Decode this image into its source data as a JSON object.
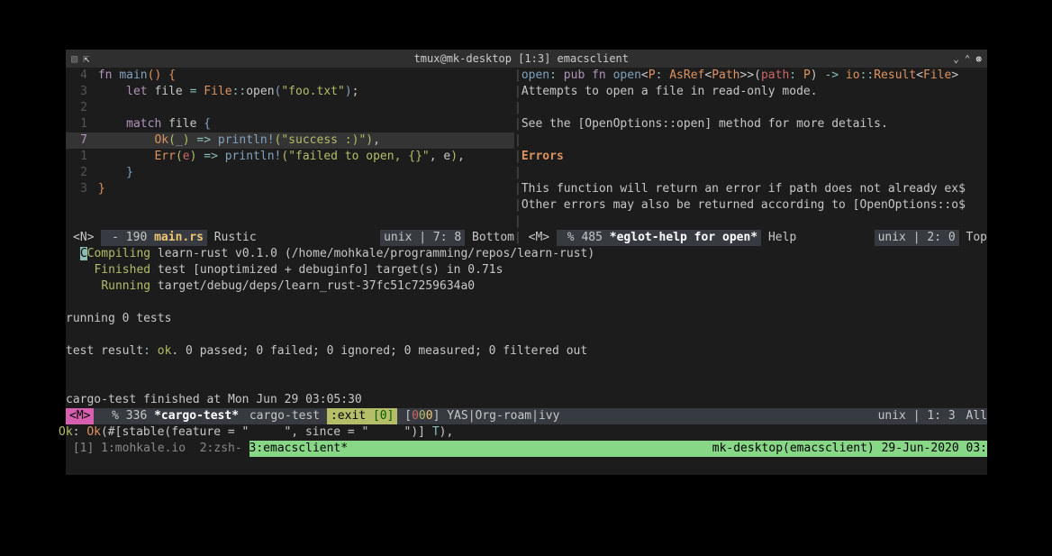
{
  "titlebar": {
    "title": "tmux@mk-desktop [1:3] emacsclient"
  },
  "code": {
    "lines": [
      {
        "n": "4",
        "active": false,
        "seg": [
          [
            "kw",
            "fn "
          ],
          [
            "fn",
            "main"
          ],
          [
            "paren1",
            "()"
          ],
          [
            "",
            ""
          ],
          [
            "",
            ", {"
          ]
        ],
        "raw": "fn main() {"
      },
      {
        "n": "3",
        "raw": "    let file = File::open(\"foo.txt\");"
      },
      {
        "n": "2",
        "raw": ""
      },
      {
        "n": "1",
        "raw": "    match file {"
      },
      {
        "n": "7",
        "raw": "        Ok(_) => println!(\"success :)\"),",
        "active": true
      },
      {
        "n": "1",
        "raw": "        Err(e) => println!(\"failed to open, {}\", e),"
      },
      {
        "n": "2",
        "raw": "    }"
      },
      {
        "n": "3",
        "raw": "}"
      }
    ]
  },
  "doc": {
    "lines": [
      "open: pub fn open<P: AsRef<Path>>(path: P) -> io::Result<File>",
      "Attempts to open a file in read-only mode.",
      "",
      "See the [OpenOptions::open] method for more details.",
      "",
      "Errors",
      "",
      "This function will return an error if path does not already ex$",
      "Other errors may also be returned according to [OpenOptions::o$",
      ""
    ]
  },
  "modeline_left": {
    "marker": "<N>",
    "dash": " - ",
    "num": "190",
    "file": "main.rs",
    "mode": "Rustic",
    "enc": "unix",
    "pos": "7: 8",
    "loc": "Bottom"
  },
  "modeline_right": {
    "marker": "<M>",
    "pct": " % ",
    "num": "485",
    "file": "*eglot-help for open*",
    "mode": "Help",
    "enc": "unix",
    "pos": "2: 0",
    "loc": "Top"
  },
  "terminal": {
    "lines": [
      {
        "label": "Compiling",
        "cls": "t-compile",
        "rest": " learn-rust v0.1.0 (/home/mohkale/programming/repos/learn-rust)"
      },
      {
        "label": "Finished",
        "cls": "t-finish",
        "rest": " test [unoptimized + debuginfo] target(s) in 0.71s"
      },
      {
        "label": "Running",
        "cls": "t-running",
        "rest": " target/debug/deps/learn_rust-37fc51c7259634a0"
      }
    ],
    "running": "running 0 tests",
    "result_pre": "test result",
    "result_ok": "ok",
    "result_rest": ". 0 passed; 0 failed; 0 ignored; 0 measured; 0 filtered out",
    "finished": "cargo-test finished at Mon Jun 29 03:05:30"
  },
  "modeline_bottom": {
    "marker": "<M>",
    "pct": " % ",
    "num": "336",
    "file": "*cargo-test*",
    "mode": "cargo-test",
    "exit_lbl": ":exit ",
    "exit_code": "[0]",
    "nums": " [0 0 0] ",
    "n0": "0",
    "n1": "0",
    "n2": "0",
    "extra": "YAS|Org-roam|ivy",
    "enc": "unix",
    "pos": "1: 3",
    "loc": "All"
  },
  "minibuf": {
    "ok": "Ok",
    "colon": ": ",
    "okfn": "Ok",
    "rest1": "(#[stable(feature = \"     \", since = \"     \")] ",
    "T": "T",
    "rest2": "),"
  },
  "tmux": {
    "session": " [1] ",
    "w1": "1:mohkale.io  ",
    "w2": "2:zsh- ",
    "w3": "3:emacsclient*",
    "right": "mk-desktop(emacsclient) 29-Jun-2020 03:"
  }
}
